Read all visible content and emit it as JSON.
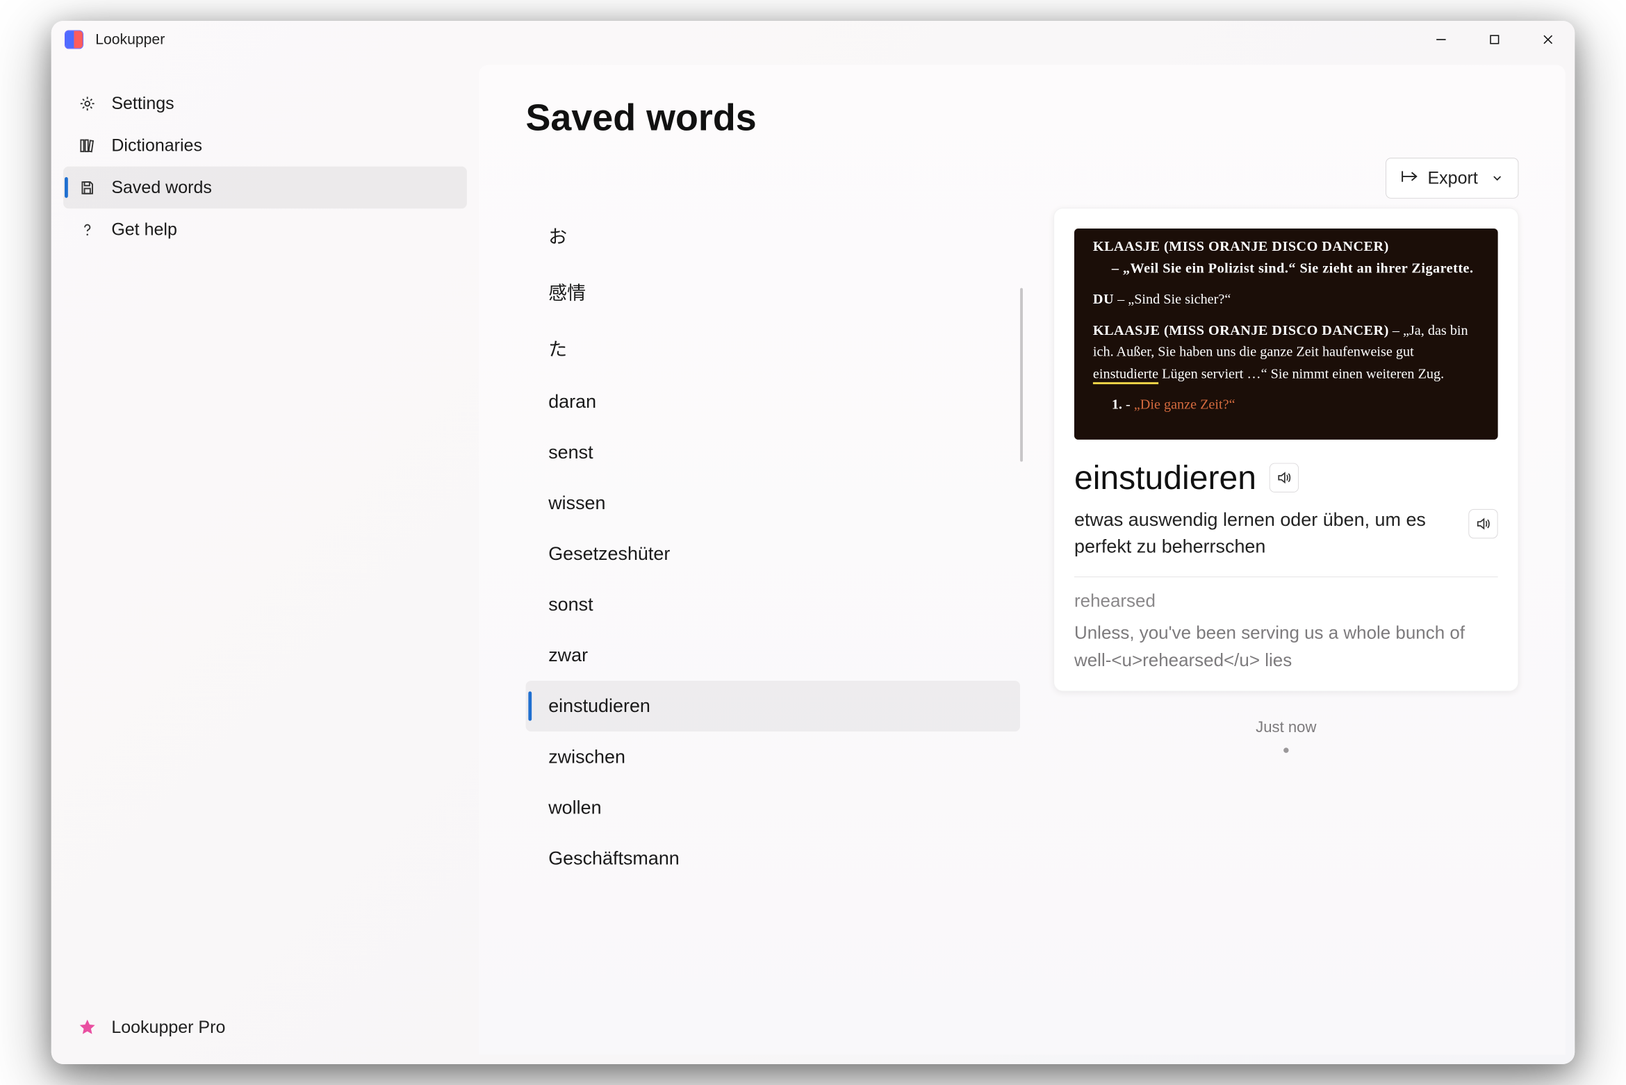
{
  "app": {
    "title": "Lookupper"
  },
  "sidebar": {
    "items": [
      {
        "label": "Settings",
        "icon": "gear-icon",
        "active": false
      },
      {
        "label": "Dictionaries",
        "icon": "books-icon",
        "active": false
      },
      {
        "label": "Saved words",
        "icon": "save-icon",
        "active": true
      },
      {
        "label": "Get help",
        "icon": "question-icon",
        "active": false
      }
    ],
    "pro_label": "Lookupper Pro"
  },
  "page": {
    "title": "Saved words",
    "export_label": "Export"
  },
  "words": [
    {
      "text": "お",
      "selected": false
    },
    {
      "text": "感情",
      "selected": false
    },
    {
      "text": "た",
      "selected": false
    },
    {
      "text": "daran",
      "selected": false
    },
    {
      "text": "senst",
      "selected": false
    },
    {
      "text": "wissen",
      "selected": false
    },
    {
      "text": "Gesetzeshüter",
      "selected": false
    },
    {
      "text": "sonst",
      "selected": false
    },
    {
      "text": "zwar",
      "selected": false
    },
    {
      "text": "einstudieren",
      "selected": true
    },
    {
      "text": "zwischen",
      "selected": false
    },
    {
      "text": "wollen",
      "selected": false
    },
    {
      "text": "Geschäftsmann",
      "selected": false
    }
  ],
  "detail": {
    "context": {
      "line0_speaker": "KLAASJE (MISS ORANJE DISCO DANCER)",
      "line0_tail": " – „Weil Sie ein Polizist sind.“ Sie zieht an ihrer Zigarette.",
      "line1_speaker": "DU",
      "line1_tail": " – „Sind Sie sicher?“",
      "line2_speaker": "KLAASJE (MISS ORANJE DISCO DANCER)",
      "line2_pre": " – „Ja, das bin ich. Außer, Sie haben uns die ganze Zeit haufenweise gut ",
      "line2_hl": "einstudierte",
      "line2_post": " Lügen serviert …“ Sie nimmt einen weiteren Zug.",
      "choice_num": "1.",
      "choice_dash": " - ",
      "choice_text": "„Die ganze Zeit?“"
    },
    "headword": "einstudieren",
    "definition": "etwas auswendig lernen oder üben, um es perfekt zu beherrschen",
    "gloss": "rehearsed",
    "example": "Unless, you've been serving us a whole bunch of well-<u>rehearsed</u> lies",
    "timestamp": "Just now"
  }
}
